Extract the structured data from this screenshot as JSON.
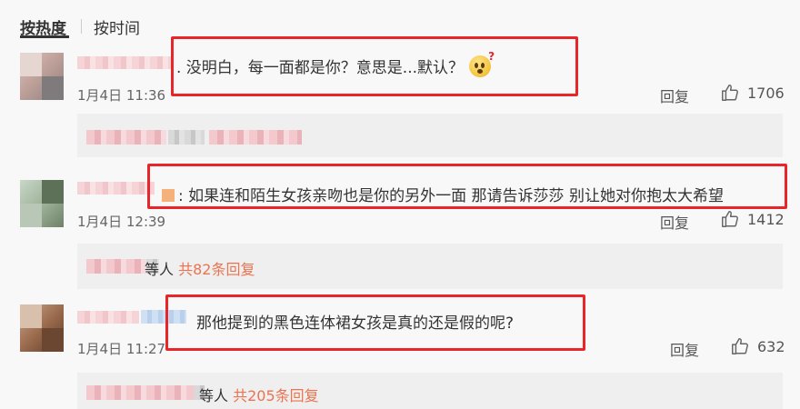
{
  "tabs": {
    "hot": "按热度",
    "time": "按时间"
  },
  "comments": [
    {
      "text": ". 没明白，每一面都是你？意思是...默认？",
      "date": "1月4日 11:36",
      "reply_label": "回复",
      "likes": "1706"
    },
    {
      "text": "如果连和陌生女孩亲吻也是你的另外一面  那请告诉莎莎  别让她对你抱太大希望",
      "date": "1月4日 12:39",
      "reply_label": "回复",
      "likes": "1412",
      "reply_summary": {
        "suffix": "等人",
        "count": "共82条回复"
      }
    },
    {
      "text": "那他提到的黑色连体裙女孩是真的还是假的呢?",
      "date": "1月4日 11:27",
      "reply_label": "回复",
      "likes": "632",
      "reply_summary": {
        "suffix": "等人",
        "count": "共205条回复"
      }
    }
  ],
  "colors": {
    "highlight_box": "#e8262a",
    "reply_count": "#eb7350"
  },
  "icons": {
    "like": "thumbs-up-icon",
    "emoji": "confused-face-icon"
  }
}
